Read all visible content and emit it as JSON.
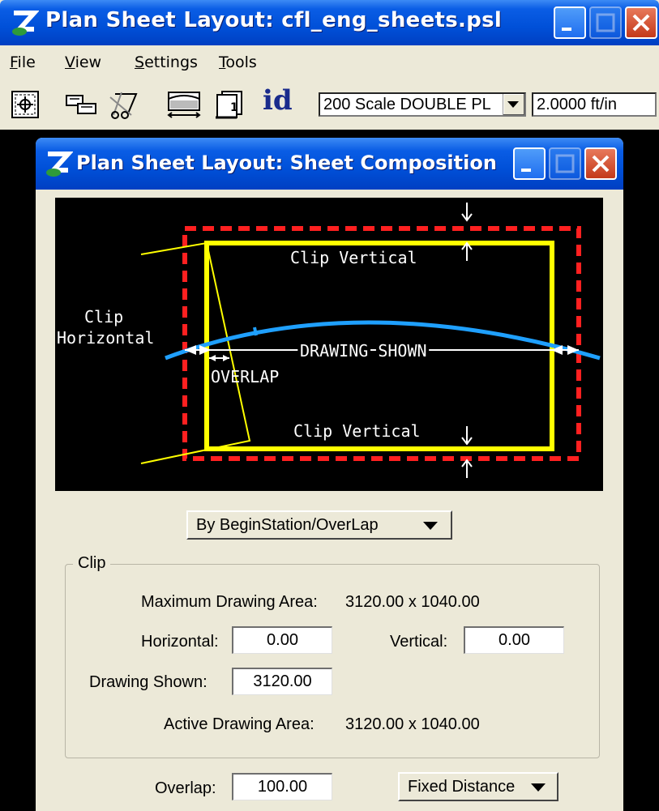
{
  "main_window": {
    "title": "Plan Sheet Layout: cfl_eng_sheets.psl",
    "menu": [
      {
        "label": "File",
        "underline": "F",
        "rest": "ile"
      },
      {
        "label": "View",
        "underline": "V",
        "rest": "iew"
      },
      {
        "label": "Settings",
        "underline": "S",
        "rest": "ettings"
      },
      {
        "label": "Tools",
        "underline": "T",
        "rest": "ools"
      }
    ],
    "toolbar": {
      "id_label": "id",
      "sheet_combo_value": "200 Scale DOUBLE PL",
      "scale_value": "2.0000 ft/in"
    }
  },
  "dialog": {
    "title": "Plan Sheet Layout: Sheet Composition",
    "diagram": {
      "clip_vertical_top": "Clip Vertical",
      "clip_vertical_bottom": "Clip Vertical",
      "clip_horizontal_line1": "Clip",
      "clip_horizontal_line2": "Horizontal",
      "drawing_shown": "DRAWING SHOWN",
      "overlap": "OVERLAP"
    },
    "mode_select": "By BeginStation/OverLap",
    "clip_group": {
      "label": "Clip",
      "max_area_label": "Maximum Drawing Area:",
      "max_area_value": "3120.00 x 1040.00",
      "horizontal_label": "Horizontal:",
      "horizontal_value": "0.00",
      "vertical_label": "Vertical:",
      "vertical_value": "0.00",
      "drawing_shown_label": "Drawing Shown:",
      "drawing_shown_value": "3120.00",
      "active_area_label": "Active Drawing Area:",
      "active_area_value": "3120.00 x 1040.00"
    },
    "overlap_label": "Overlap:",
    "overlap_value": "100.00",
    "overlap_mode": "Fixed Distance"
  }
}
